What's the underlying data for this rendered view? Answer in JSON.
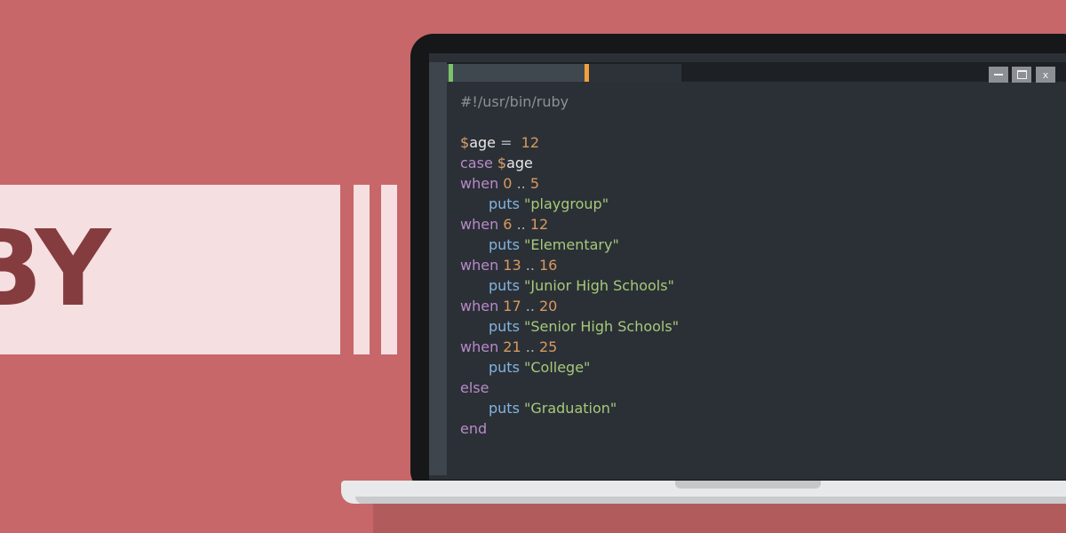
{
  "banner": {
    "text": "BY"
  },
  "editor": {
    "window_controls": {
      "minimize": "",
      "maximize": "",
      "close": "x"
    },
    "code_lines": [
      [
        {
          "t": "comment",
          "v": "#!/usr/bin/ruby"
        }
      ],
      [],
      [
        {
          "t": "dollar",
          "v": "$"
        },
        {
          "t": "var",
          "v": "age"
        },
        {
          "t": "op",
          "v": " =  "
        },
        {
          "t": "num",
          "v": "12"
        }
      ],
      [
        {
          "t": "kw",
          "v": "case "
        },
        {
          "t": "dollar",
          "v": "$"
        },
        {
          "t": "var",
          "v": "age"
        }
      ],
      [
        {
          "t": "kw",
          "v": "when "
        },
        {
          "t": "num",
          "v": "0"
        },
        {
          "t": "op",
          "v": " .. "
        },
        {
          "t": "num",
          "v": "5"
        }
      ],
      [
        {
          "t": "indent",
          "v": ""
        },
        {
          "t": "fn",
          "v": "puts "
        },
        {
          "t": "str",
          "v": "\"playgroup\""
        }
      ],
      [
        {
          "t": "kw",
          "v": "when "
        },
        {
          "t": "num",
          "v": "6"
        },
        {
          "t": "op",
          "v": " .. "
        },
        {
          "t": "num",
          "v": "12"
        }
      ],
      [
        {
          "t": "indent",
          "v": ""
        },
        {
          "t": "fn",
          "v": "puts "
        },
        {
          "t": "str",
          "v": "\"Elementary\""
        }
      ],
      [
        {
          "t": "kw",
          "v": "when "
        },
        {
          "t": "num",
          "v": "13"
        },
        {
          "t": "op",
          "v": " .. "
        },
        {
          "t": "num",
          "v": "16"
        }
      ],
      [
        {
          "t": "indent",
          "v": ""
        },
        {
          "t": "fn",
          "v": "puts "
        },
        {
          "t": "str",
          "v": "\"Junior High Schools\""
        }
      ],
      [
        {
          "t": "kw",
          "v": "when "
        },
        {
          "t": "num",
          "v": "17"
        },
        {
          "t": "op",
          "v": " .. "
        },
        {
          "t": "num",
          "v": "20"
        }
      ],
      [
        {
          "t": "indent",
          "v": ""
        },
        {
          "t": "fn",
          "v": "puts "
        },
        {
          "t": "str",
          "v": "\"Senior High Schools\""
        }
      ],
      [
        {
          "t": "kw",
          "v": "when "
        },
        {
          "t": "num",
          "v": "21"
        },
        {
          "t": "op",
          "v": " .. "
        },
        {
          "t": "num",
          "v": "25"
        }
      ],
      [
        {
          "t": "indent",
          "v": ""
        },
        {
          "t": "fn",
          "v": "puts "
        },
        {
          "t": "str",
          "v": "\"College\""
        }
      ],
      [
        {
          "t": "kw",
          "v": "else"
        }
      ],
      [
        {
          "t": "indent",
          "v": ""
        },
        {
          "t": "fn",
          "v": "puts "
        },
        {
          "t": "str",
          "v": "\"Graduation\""
        }
      ],
      [
        {
          "t": "kw",
          "v": "end"
        }
      ]
    ]
  },
  "colors": {
    "background": "#c76769",
    "banner": "#f6dfe0",
    "banner_text": "#853c3f",
    "editor_bg": "#2b3036",
    "tab_marker_green": "#7bc36b",
    "tab_marker_orange": "#f0a03c"
  }
}
